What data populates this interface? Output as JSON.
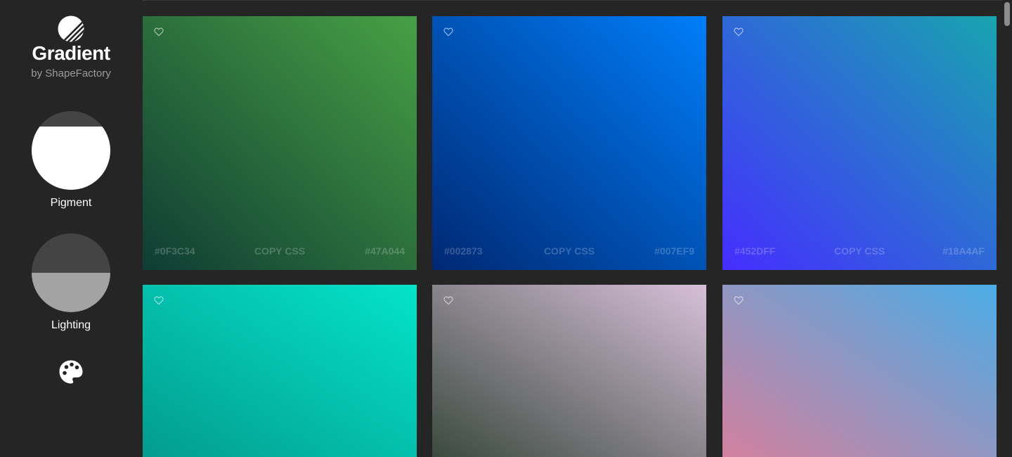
{
  "brand": {
    "title": "Gradient",
    "subtitle": "by ShapeFactory",
    "logo_icon": "striped-circle-logo-icon"
  },
  "controls": {
    "pigment": {
      "label": "Pigment",
      "level": 0.2
    },
    "lighting": {
      "label": "Lighting",
      "level": 0.5
    },
    "palette_icon": "palette-icon"
  },
  "gradients": [
    {
      "from": "#0F3C34",
      "to": "#47A044",
      "copy_label": "COPY CSS",
      "footer_color": "rgba(255,255,255,0.22)"
    },
    {
      "from": "#002873",
      "to": "#007EF9",
      "copy_label": "COPY CSS",
      "footer_color": "rgba(255,255,255,0.22)"
    },
    {
      "from": "#452DFF",
      "to": "#18A4AF",
      "copy_label": "COPY CSS",
      "footer_color": "rgba(255,255,255,0.22)"
    },
    {
      "from": "#039C8E",
      "to": "#04E3C9",
      "copy_label": "",
      "footer_color": "rgba(255,255,255,0.22)"
    },
    {
      "from": "#3B4A3F",
      "to": "#D7BFD9",
      "copy_label": "",
      "footer_color": "rgba(255,255,255,0.22)"
    },
    {
      "from": "#D3809E",
      "to": "#4BACE6",
      "copy_label": "",
      "footer_color": "rgba(255,255,255,0.22)"
    }
  ],
  "colors": {
    "background": "#252525",
    "text": "#FFFFFF",
    "muted": "#9C9C9C",
    "dial_dark": "#444444",
    "dial_white": "#FFFFFF",
    "dial_gray": "#A3A3A3"
  }
}
